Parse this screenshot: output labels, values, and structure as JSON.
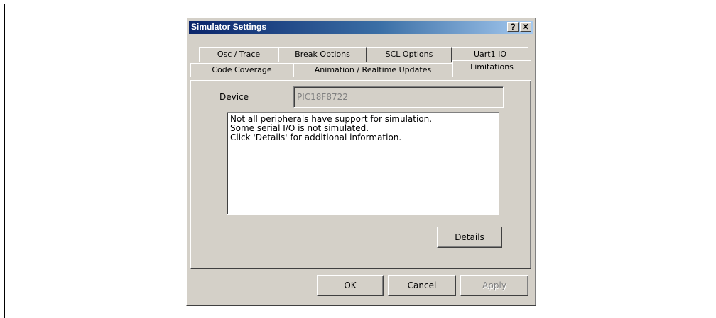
{
  "dialog": {
    "title": "Simulator Settings",
    "help_label": "?",
    "close_label": "✕"
  },
  "tabs": {
    "row1": [
      "Osc / Trace",
      "Break Options",
      "SCL Options",
      "Uart1  IO"
    ],
    "row2": [
      "Code Coverage",
      "Animation / Realtime  Updates",
      "Limitations"
    ],
    "active": "Limitations"
  },
  "limitations": {
    "device_label": "Device",
    "device_value": "PIC18F8722",
    "lines": [
      "Not all peripherals have support for simulation.",
      "Some serial I/O is not simulated.",
      "Click 'Details' for additional information."
    ],
    "details_label": "Details"
  },
  "footer": {
    "ok_label": "OK",
    "cancel_label": "Cancel",
    "apply_label": "Apply"
  }
}
